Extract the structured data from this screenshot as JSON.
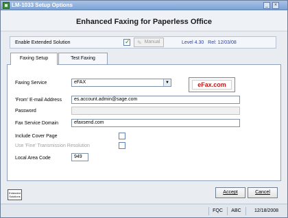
{
  "window": {
    "title": "LM-1033 Setup Options"
  },
  "header": {
    "title": "Enhanced Faxing for Paperless Office"
  },
  "extended": {
    "label": "Enable Extended Solution",
    "checked": true,
    "check_glyph": "✓",
    "manual_label": "Manual",
    "level_text": "Level 4.30",
    "rel_text": "Rel: 12/03/08"
  },
  "tabs": [
    {
      "label": "Faxing Setup",
      "active": true
    },
    {
      "label": "Test Faxing",
      "active": false
    }
  ],
  "form": {
    "faxing_service_label": "Faxing Service",
    "faxing_service_value": "eFAX",
    "from_email_label": "'From' E-mail Address",
    "from_email_value": "es.account.admin@sage.com",
    "password_label": "Password",
    "password_value": "",
    "domain_label": "Fax Service Domain",
    "domain_value": "efaxsend.com",
    "cover_page_label": "Include Cover Page",
    "fine_res_label": "Use 'Fine' Transmission Resolution",
    "area_code_label": "Local Area Code",
    "area_code_value": "949",
    "logo_text": "eFax.com"
  },
  "buttons": {
    "extended_solutions_line1": "Extended",
    "extended_solutions_line2": "Solutions",
    "accept": "Accept",
    "cancel": "Cancel"
  },
  "status": {
    "company": "FQC",
    "code": "ABC",
    "date": "12/18/2008"
  },
  "colors": {
    "link_blue": "#2a3fa8",
    "logo_red": "#c01818"
  }
}
